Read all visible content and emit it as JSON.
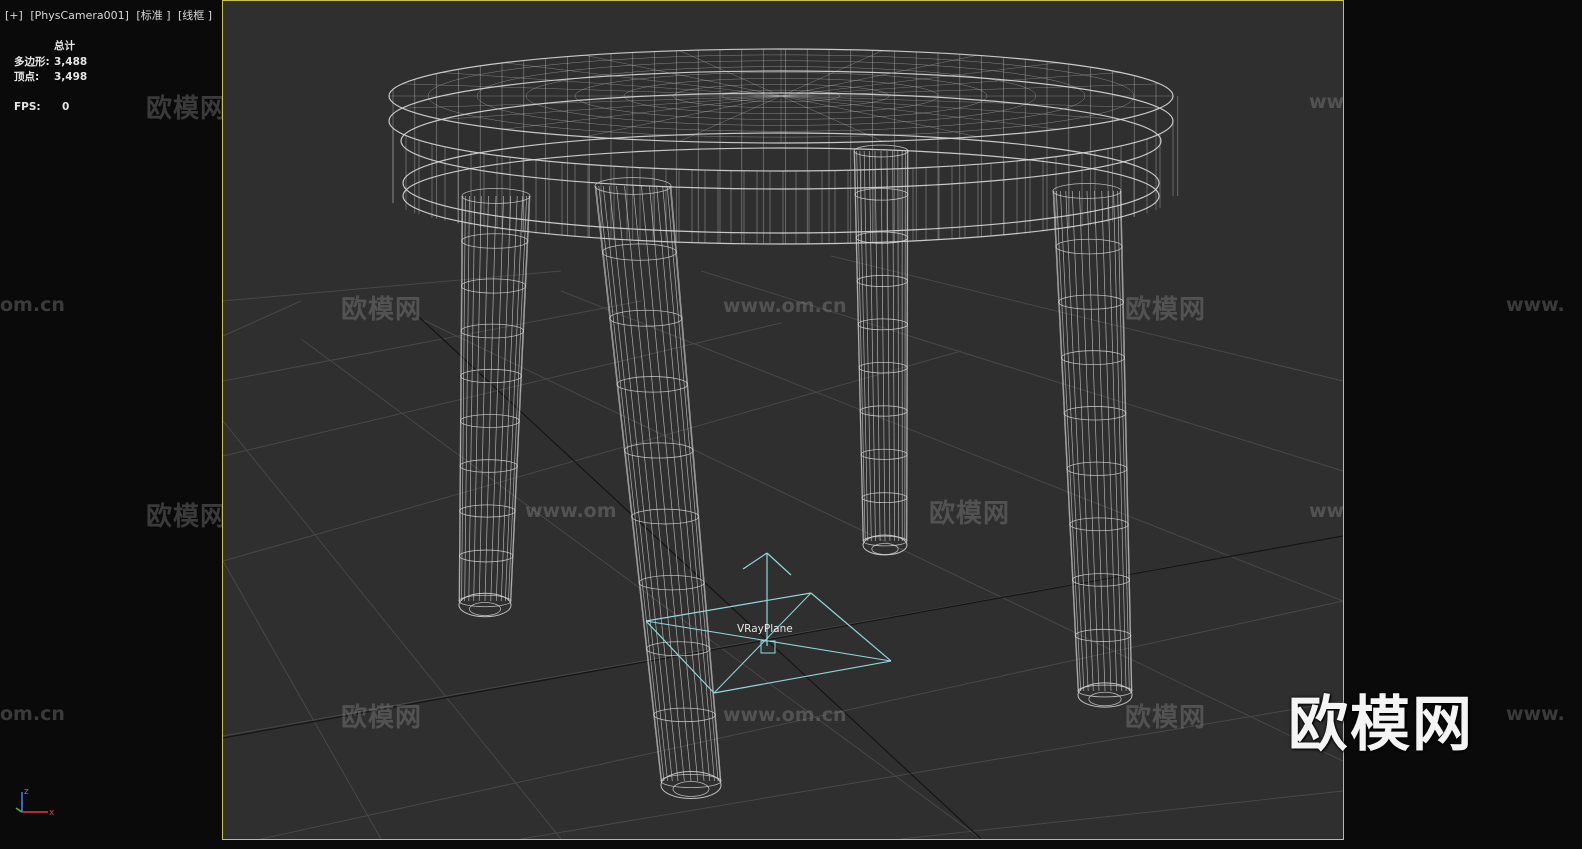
{
  "viewport": {
    "label_parts": [
      "[+]",
      "[PhysCamera001]",
      "[标准 ]",
      "[线框 ]"
    ]
  },
  "stats": {
    "header": "总计",
    "polygons_label": "多边形:",
    "polygons_value": "3,488",
    "vertices_label": "顶点:",
    "vertices_value": "3,498",
    "fps_label": "FPS:",
    "fps_value": "0"
  },
  "scene": {
    "object_label": "VRayPlane"
  },
  "axis": {
    "x": "x",
    "z": "z"
  },
  "watermark": {
    "brand": "欧模网",
    "url": "www.om.cn",
    "url_partial_left": "om.cn",
    "url_partial_right": "www.",
    "url_partial_mid": "www.om"
  },
  "colors": {
    "viewport_bg": "#2f2f2f",
    "side_bg": "#0a0a0a",
    "wire": "#d9d9d9",
    "grid": "#474747",
    "frame": "#c9c24a",
    "gizmo": "#8fd8dc"
  }
}
